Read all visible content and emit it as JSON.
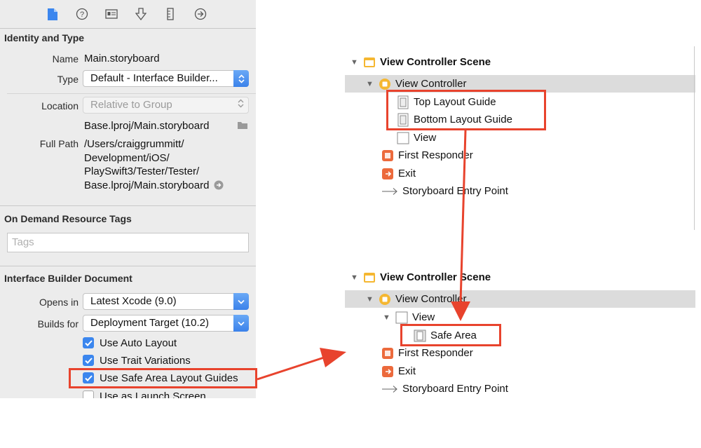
{
  "inspector": {
    "identity": {
      "title": "Identity and Type",
      "name_label": "Name",
      "name_value": "Main.storyboard",
      "type_label": "Type",
      "type_value": "Default - Interface Builder...",
      "location_label": "Location",
      "location_value": "Relative to Group",
      "relative_path": "Base.lproj/Main.storyboard",
      "fullpath_label": "Full Path",
      "fullpath_lines": [
        "/Users/craiggrummitt/",
        "Development/iOS/",
        "PlaySwift3/Tester/Tester/",
        "Base.lproj/Main.storyboard"
      ]
    },
    "on_demand": {
      "title": "On Demand Resource Tags",
      "tags_placeholder": "Tags"
    },
    "ib_document": {
      "title": "Interface Builder Document",
      "opens_in_label": "Opens in",
      "opens_in_value": "Latest Xcode (9.0)",
      "builds_for_label": "Builds for",
      "builds_for_value": "Deployment Target (10.2)",
      "checkboxes": [
        {
          "label": "Use Auto Layout",
          "checked": true
        },
        {
          "label": "Use Trait Variations",
          "checked": true
        },
        {
          "label": "Use Safe Area Layout Guides",
          "checked": true
        },
        {
          "label": "Use as Launch Screen",
          "checked": false
        }
      ]
    }
  },
  "outline_before": {
    "scene": "View Controller Scene",
    "controller": "View Controller",
    "top_guide": "Top Layout Guide",
    "bottom_guide": "Bottom Layout Guide",
    "view": "View",
    "first_responder": "First Responder",
    "exit": "Exit",
    "entry_point": "Storyboard Entry Point"
  },
  "outline_after": {
    "scene": "View Controller Scene",
    "controller": "View Controller",
    "view": "View",
    "safe_area": "Safe Area",
    "first_responder": "First Responder",
    "exit": "Exit",
    "entry_point": "Storyboard Entry Point"
  },
  "colors": {
    "highlight": "#e8432d",
    "accent": "#3b86ee",
    "selection": "#dcdcdc"
  }
}
